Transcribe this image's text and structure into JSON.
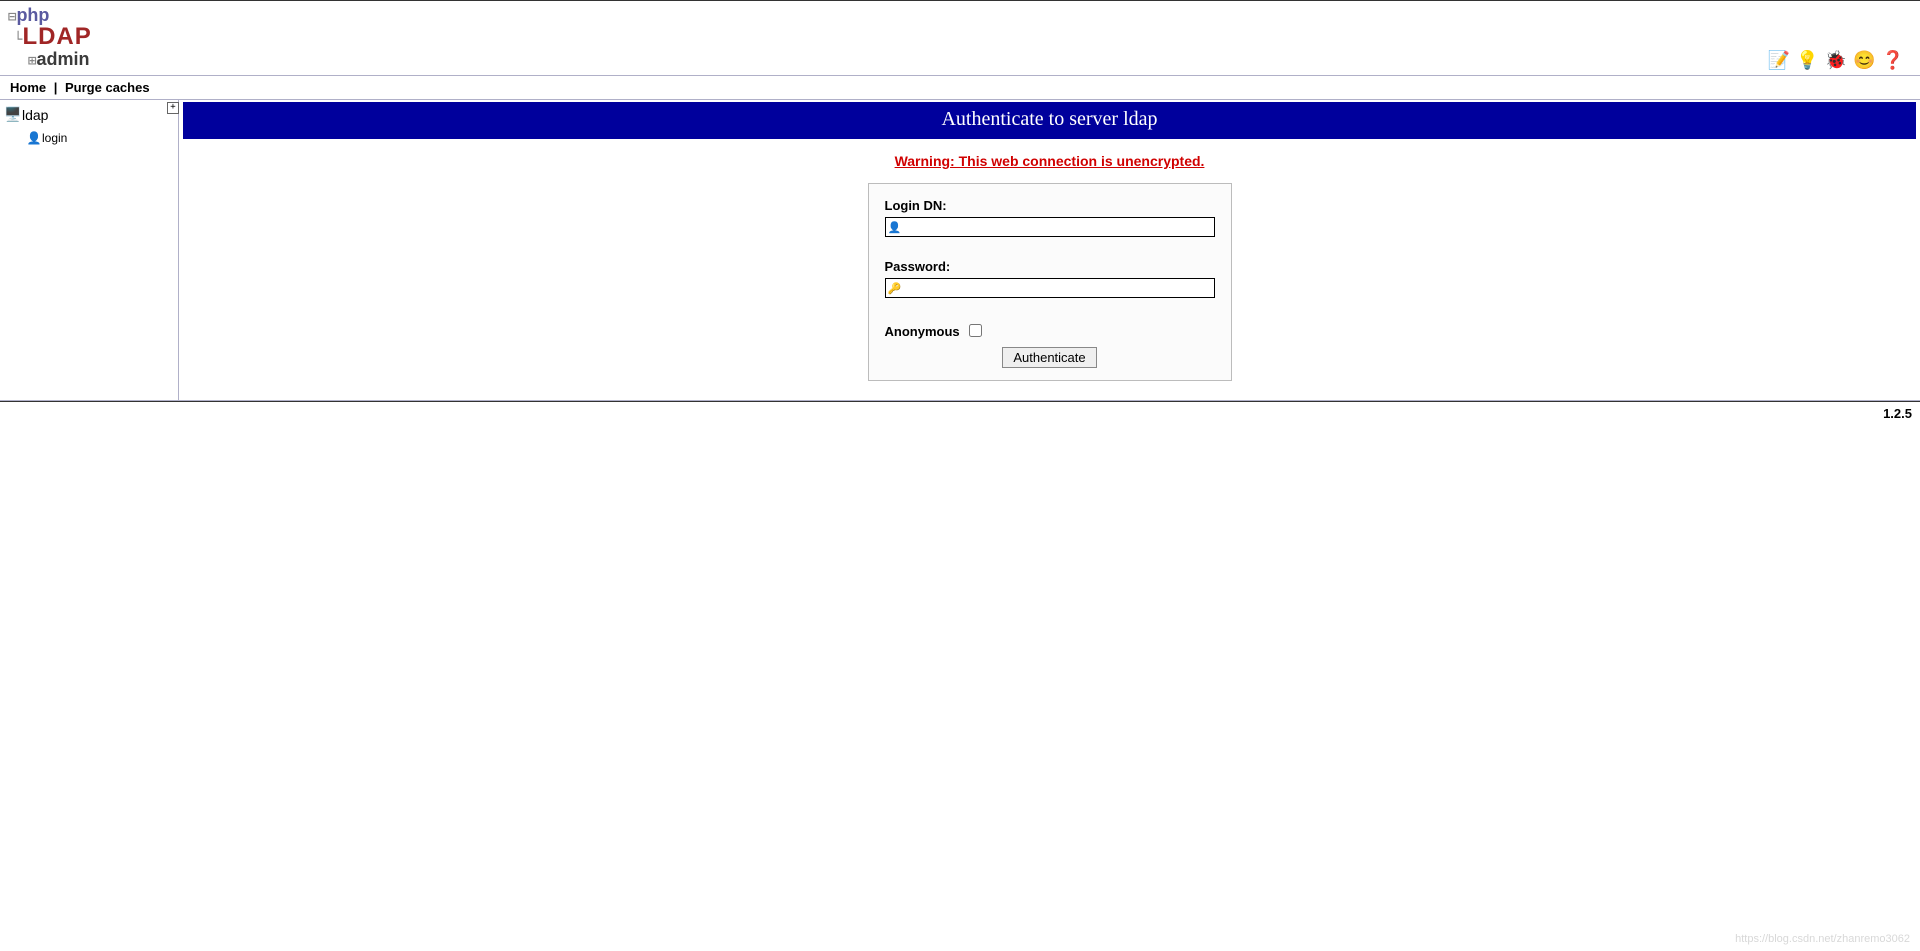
{
  "logo": {
    "php": "php",
    "ldap": "LDAP",
    "admin": "admin"
  },
  "nav": {
    "home": "Home",
    "purge": "Purge caches",
    "separator": "|"
  },
  "sidebar": {
    "server_name": "ldap",
    "login_label": "login",
    "plus_glyph": "+"
  },
  "main": {
    "title": "Authenticate to server ldap",
    "warning": "Warning: This web connection is unencrypted."
  },
  "form": {
    "login_dn_label": "Login DN:",
    "login_dn_value": "",
    "password_label": "Password:",
    "password_value": "",
    "anonymous_label": "Anonymous",
    "submit_label": "Authenticate"
  },
  "footer": {
    "version": "1.2.5"
  },
  "watermark": "https://blog.csdn.net/zhanremo3062"
}
